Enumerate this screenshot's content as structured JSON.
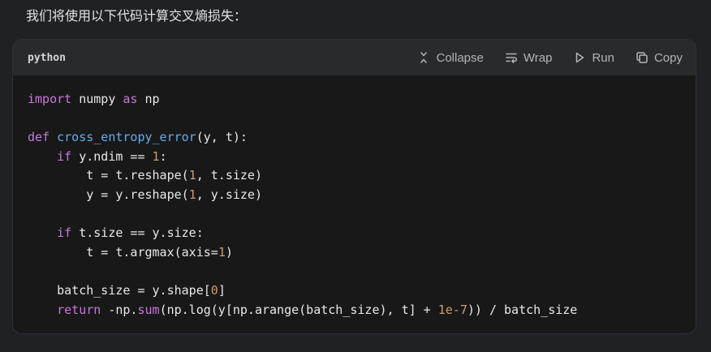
{
  "intro_text": "我们将使用以下代码计算交叉熵损失：",
  "code_block": {
    "language": "python",
    "actions": {
      "collapse": "Collapse",
      "wrap": "Wrap",
      "run": "Run",
      "copy": "Copy"
    },
    "lines": [
      {
        "indent": "",
        "tokens": [
          {
            "t": "import",
            "c": "kw-purple"
          },
          {
            "t": " numpy "
          },
          {
            "t": "as",
            "c": "kw-purple"
          },
          {
            "t": " np"
          }
        ]
      },
      {
        "indent": "",
        "tokens": []
      },
      {
        "indent": "",
        "tokens": [
          {
            "t": "def",
            "c": "kw-purple"
          },
          {
            "t": " "
          },
          {
            "t": "cross_entropy_error",
            "c": "fn-blue"
          },
          {
            "t": "(y, t):"
          }
        ]
      },
      {
        "indent": "    ",
        "tokens": [
          {
            "t": "if",
            "c": "kw-purple"
          },
          {
            "t": " y.ndim == "
          },
          {
            "t": "1",
            "c": "num"
          },
          {
            "t": ":"
          }
        ]
      },
      {
        "indent": "        ",
        "tokens": [
          {
            "t": "t = t.reshape("
          },
          {
            "t": "1",
            "c": "num"
          },
          {
            "t": ", t.size)"
          }
        ]
      },
      {
        "indent": "        ",
        "tokens": [
          {
            "t": "y = y.reshape("
          },
          {
            "t": "1",
            "c": "num"
          },
          {
            "t": ", y.size)"
          }
        ]
      },
      {
        "indent": "",
        "tokens": []
      },
      {
        "indent": "    ",
        "tokens": [
          {
            "t": "if",
            "c": "kw-purple"
          },
          {
            "t": " t.size == y.size:"
          }
        ]
      },
      {
        "indent": "        ",
        "tokens": [
          {
            "t": "t = t.argmax(axis="
          },
          {
            "t": "1",
            "c": "num"
          },
          {
            "t": ")"
          }
        ]
      },
      {
        "indent": "",
        "tokens": []
      },
      {
        "indent": "    ",
        "tokens": [
          {
            "t": "batch_size = y.shape["
          },
          {
            "t": "0",
            "c": "num"
          },
          {
            "t": "]"
          }
        ]
      },
      {
        "indent": "    ",
        "tokens": [
          {
            "t": "return",
            "c": "kw-purple"
          },
          {
            "t": " -np."
          },
          {
            "t": "sum",
            "c": "kw-purple"
          },
          {
            "t": "(np.log(y[np.arange(batch_size), t] + "
          },
          {
            "t": "1e-7",
            "c": "num"
          },
          {
            "t": ")) / batch_size"
          }
        ]
      }
    ]
  },
  "icons": {
    "collapse": "collapse-icon",
    "wrap": "wrap-icon",
    "run": "play-icon",
    "copy": "copy-icon"
  },
  "colors": {
    "page_bg": "#202124",
    "card_bg": "#181818",
    "header_bg": "#282a2c",
    "keyword": "#c678dd",
    "function": "#61afef",
    "number": "#d19a66"
  }
}
